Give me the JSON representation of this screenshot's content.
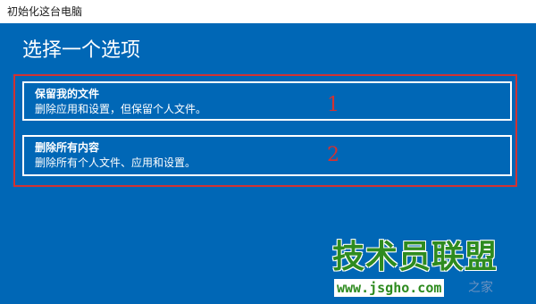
{
  "window": {
    "title": "初始化这台电脑"
  },
  "page": {
    "title": "选择一个选项"
  },
  "options": [
    {
      "title": "保留我的文件",
      "description": "删除应用和设置，但保留个人文件。",
      "annotation_number": "1"
    },
    {
      "title": "删除所有内容",
      "description": "删除所有个人文件、应用和设置。",
      "annotation_number": "2"
    }
  ],
  "watermark": {
    "logo_text": "技术员联盟",
    "url": "www.jsgho.com",
    "suffix": "之家"
  },
  "colors": {
    "background": "#0067b6",
    "titlebar": "#ffffff",
    "annotation": "#d23232",
    "watermark": "#2e8b1f"
  }
}
